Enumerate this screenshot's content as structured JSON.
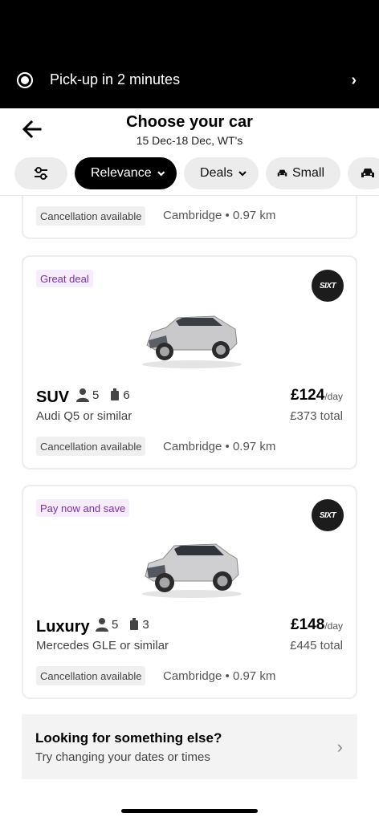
{
  "pickup": {
    "text": "Pick-up in 2 minutes",
    "chevron": "›"
  },
  "header": {
    "title": "Choose your car",
    "subtitle": "15 Dec-18 Dec, WT's"
  },
  "filters": {
    "sort_label": "Relevance",
    "deals_label": "Deals",
    "small_label": "Small"
  },
  "cards": [
    {
      "cancellation": "Cancellation available",
      "location": "Cambridge • 0.97 km"
    },
    {
      "deal": "Great deal",
      "provider": "SIXT",
      "car_class": "SUV",
      "seats": "5",
      "bags": "6",
      "model": "Audi Q5 or similar",
      "price": "£124",
      "per": "/day",
      "total": "£373 total",
      "cancellation": "Cancellation available",
      "location": "Cambridge • 0.97 km"
    },
    {
      "deal": "Pay now and save",
      "provider": "SIXT",
      "car_class": "Luxury",
      "seats": "5",
      "bags": "3",
      "model": "Mercedes GLE or similar",
      "price": "£148",
      "per": "/day",
      "total": "£445 total",
      "cancellation": "Cancellation available",
      "location": "Cambridge • 0.97 km"
    }
  ],
  "else_box": {
    "title": "Looking for something else?",
    "subtitle": "Try changing your dates or times",
    "chevron": "›"
  },
  "icons": {
    "accent_purple": "#7b2fa8"
  }
}
